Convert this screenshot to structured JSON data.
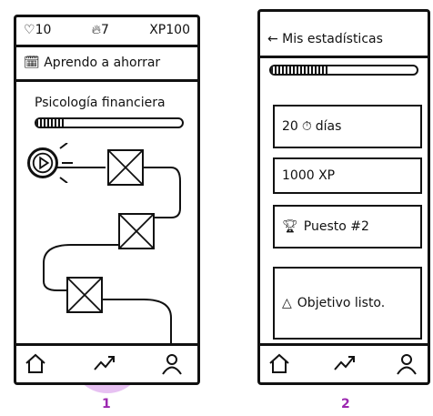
{
  "frames": [
    {
      "label": "1",
      "stats": {
        "lives": "10",
        "streak": "7",
        "xp": "XP100"
      },
      "lesson_title": "Aprendo a ahorrar",
      "section_title": "Psicología financiera",
      "section_progress": 0.2,
      "nav": {
        "items": [
          "home",
          "progress",
          "profile"
        ],
        "active": "progress"
      }
    },
    {
      "label": "2",
      "title": "← Mis estadísticas",
      "progress": 0.4,
      "cards": [
        {
          "text": "20",
          "suffix": "días"
        },
        {
          "text": "1000 XP"
        },
        {
          "text": "Puesto #2"
        },
        {
          "text": "Objetivo listo."
        }
      ],
      "nav": {
        "items": [
          "home",
          "progress",
          "profile"
        ]
      }
    }
  ],
  "colors": {
    "highlight": "#e3b6f0",
    "label": "#9c27b0",
    "ink": "#111111"
  }
}
